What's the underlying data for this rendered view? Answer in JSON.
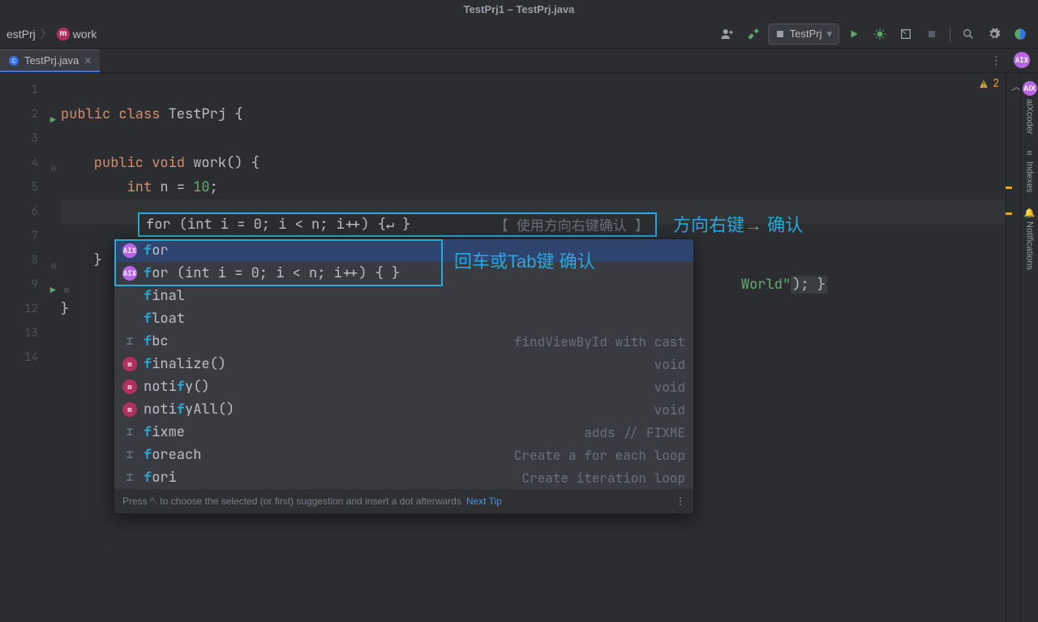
{
  "titlebar": "TestPrj1 – TestPrj.java",
  "breadcrumb": {
    "root": "estPrj",
    "method": "work"
  },
  "runConfig": "TestPrj",
  "tab": {
    "label": "TestPrj.java"
  },
  "warnings": "2",
  "code": {
    "l2_a": "public",
    "l2_b": " class",
    "l2_c": " TestPrj {",
    "l4_a": "    public",
    "l4_b": " void",
    "l4_c": " work() {",
    "l5_a": "        int",
    "l5_b": " n = ",
    "l5_c": "10",
    "l5_d": ";",
    "l6": "        ",
    "l8": "    }",
    "l9_b": "World\"",
    "l9_c": "); }",
    "l12": "}"
  },
  "inlineSuggestion": {
    "text": "for (int i = 0; i < n; i++) {↵          }",
    "hint": "【 使用方向右键确认 】"
  },
  "annotation1": "方向右键→ 确认",
  "annotation2": "回车或Tab键 确认",
  "completion": {
    "items": [
      {
        "icon": "aix",
        "prefix": "f",
        "rest": "or",
        "hint": ""
      },
      {
        "icon": "aix",
        "prefix": "f",
        "rest": "or (int i = 0; i < n; i++) {  }",
        "hint": ""
      },
      {
        "icon": "",
        "prefix": "f",
        "rest": "inal",
        "hint": ""
      },
      {
        "icon": "",
        "prefix": "f",
        "rest": "loat",
        "hint": ""
      },
      {
        "icon": "tpl",
        "prefix": "f",
        "rest": "bc",
        "hint": "findViewById with cast"
      },
      {
        "icon": "m",
        "prefix": "f",
        "rest": "inalize()",
        "hint": "void"
      },
      {
        "icon": "m",
        "prefix": "",
        "rest": "noti",
        "rest2": "f",
        "rest3": "y()",
        "hint": "void"
      },
      {
        "icon": "m",
        "prefix": "",
        "rest": "noti",
        "rest2": "f",
        "rest3": "yAll()",
        "hint": "void"
      },
      {
        "icon": "tpl",
        "prefix": "f",
        "rest": "ixme",
        "hint": "adds // FIXME"
      },
      {
        "icon": "tpl",
        "prefix": "f",
        "rest": "oreach",
        "hint": "Create a for each loop"
      },
      {
        "icon": "tpl",
        "prefix": "f",
        "rest": "ori",
        "hint": "Create iteration loop"
      }
    ],
    "footer": "Press ^. to choose the selected (or first) suggestion and insert a dot afterwards",
    "next": "Next Tip"
  },
  "lines": [
    "1",
    "2",
    "3",
    "4",
    "5",
    "6",
    "7",
    "8",
    "9",
    "12",
    "13",
    "14"
  ],
  "rail": {
    "a": "aiXcoder",
    "b": "Indexes",
    "c": "Notifications"
  }
}
